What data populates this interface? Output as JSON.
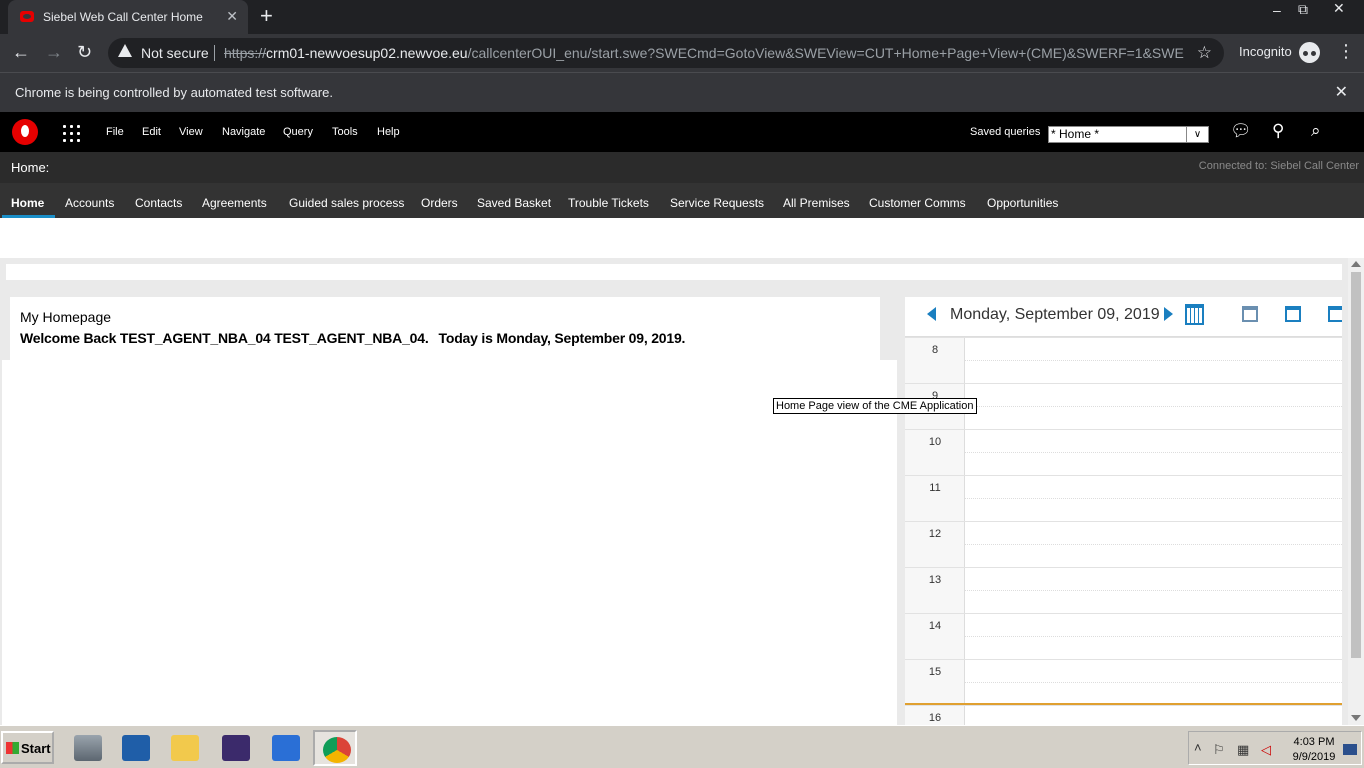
{
  "browser": {
    "tab_title": "Siebel Web Call Center Home",
    "tab_close": "✕",
    "new_tab": "+",
    "window_controls": {
      "minimize": "–",
      "restore": "⧉",
      "close": "✕"
    },
    "security_label": "Not secure",
    "url_scheme": "https://",
    "url_host": "crm01-newvoesup02.newvoe.eu",
    "url_path": "/callcenterOUI_enu/start.swe?SWECmd=GotoView&SWEView=CUT+Home+Page+View+(CME)&SWERF=1&SWE...",
    "incognito_label": "Incognito",
    "automation_message": "Chrome is being controlled by automated test software."
  },
  "siebel": {
    "menu": [
      "File",
      "Edit",
      "View",
      "Navigate",
      "Query",
      "Tools",
      "Help"
    ],
    "saved_queries_label": "Saved queries",
    "saved_query_value": "* Home *",
    "breadcrumb": "Home:",
    "connection_status": "Connected to: Siebel Call Center",
    "screen_tabs": [
      "Home",
      "Accounts",
      "Contacts",
      "Agreements",
      "Guided sales process",
      "Orders",
      "Saved Basket",
      "Trouble Tickets",
      "Service Requests",
      "All Premises",
      "Customer Comms",
      "Opportunities"
    ],
    "active_tab": "Home"
  },
  "homepage": {
    "title": "My Homepage",
    "welcome": "Welcome Back TEST_AGENT_NBA_04 TEST_AGENT_NBA_04.",
    "today": "Today is Monday, September 09, 2019."
  },
  "calendar": {
    "date": "Monday, September 09, 2019",
    "hours": [
      "8",
      "9",
      "10",
      "11",
      "12",
      "13",
      "14",
      "15",
      "16"
    ]
  },
  "tooltip": "Home Page view of the CME Application",
  "taskbar": {
    "start_label": "Start",
    "clock_time": "4:03 PM",
    "clock_date": "9/9/2019",
    "apps": [
      "server-manager-icon",
      "powershell-icon",
      "file-explorer-icon",
      "java-ee-ide-icon",
      "wps-icon",
      "chrome-icon"
    ]
  },
  "colors": {
    "vodafone_red": "#e60000",
    "accent_blue": "#1a7fc0",
    "active_tab_underline": "#1a8ec7"
  }
}
